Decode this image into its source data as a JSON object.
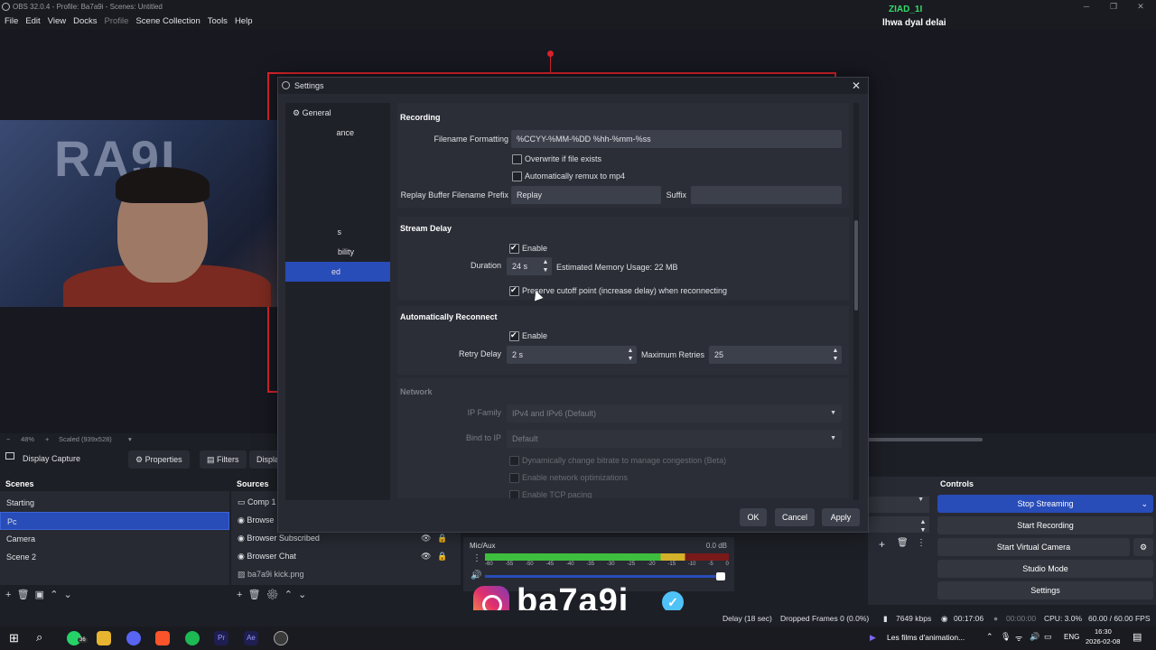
{
  "window": {
    "title": "OBS 32.0.4 - Profile: Ba7a9i - Scenes: Untitled"
  },
  "menu": [
    "File",
    "Edit",
    "View",
    "Docks",
    "Profile",
    "Scene Collection",
    "Tools",
    "Help"
  ],
  "overlay": {
    "name": "ZIAD_1I",
    "chat": "lhwa dyal delai"
  },
  "zoom": {
    "percent": "48%",
    "scaled": "Scaled (939x528)"
  },
  "source_toolbar": {
    "source": "Display Capture",
    "properties": "Properties",
    "filters": "Filters",
    "display": "Displa"
  },
  "scenes": {
    "title": "Scenes",
    "items": [
      "Starting",
      "Pc",
      "Camera",
      "Scene 2"
    ],
    "selected": 1
  },
  "sources": {
    "title": "Sources",
    "items": [
      "Comp 1",
      "Browse",
      "Browser Subscribed",
      "Browser Chat",
      "ba7a9i kick.png"
    ]
  },
  "mixer": {
    "channel": "Mic/Aux",
    "level": "0.0 dB",
    "ticks": [
      "-60",
      "-55",
      "-50",
      "-45",
      "-40",
      "-35",
      "-30",
      "-25",
      "-20",
      "-15",
      "-10",
      "-5",
      "0"
    ]
  },
  "controls": {
    "title": "Controls",
    "stop_streaming": "Stop Streaming",
    "start_recording": "Start Recording",
    "start_virtual_camera": "Start Virtual Camera",
    "studio_mode": "Studio Mode",
    "settings": "Settings"
  },
  "status": {
    "delay": "Delay (18 sec)",
    "dropped": "Dropped Frames 0 (0.0%)",
    "kbps": "7649 kbps",
    "stream_time": "00:17:06",
    "rec_time": "00:00:00",
    "cpu": "CPU: 3.0%",
    "fps": "60.00 / 60.00 FPS"
  },
  "taskbar": {
    "notification": "Les films d'animation...",
    "lang": "ENG",
    "time": "16:30",
    "date": "2026-02-08",
    "badge": "36"
  },
  "instagram": {
    "handle": "ba7a9i"
  },
  "settings": {
    "title": "Settings",
    "nav": [
      "General",
      "ance",
      "s",
      "bility",
      "ed"
    ],
    "recording": {
      "title": "Recording",
      "filename_label": "Filename Formatting",
      "filename_value": "%CCYY-%MM-%DD %hh-%mm-%ss",
      "overwrite": "Overwrite if file exists",
      "remux": "Automatically remux to mp4",
      "prefix_label": "Replay Buffer Filename Prefix",
      "prefix_value": "Replay",
      "suffix_label": "Suffix",
      "suffix_value": ""
    },
    "stream_delay": {
      "title": "Stream Delay",
      "enable": "Enable",
      "duration_label": "Duration",
      "duration_value": "24 s",
      "memory": "Estimated Memory Usage: 22 MB",
      "preserve": "Preserve cutoff point (increase delay) when reconnecting"
    },
    "reconnect": {
      "title": "Automatically Reconnect",
      "enable": "Enable",
      "retry_label": "Retry Delay",
      "retry_value": "2 s",
      "max_label": "Maximum Retries",
      "max_value": "25"
    },
    "network": {
      "title": "Network",
      "ip_family_label": "IP Family",
      "ip_family_value": "IPv4 and IPv6 (Default)",
      "bind_label": "Bind to IP",
      "bind_value": "Default",
      "dynamic": "Dynamically change bitrate to manage congestion (Beta)",
      "optimizations": "Enable network optimizations",
      "tcp": "Enable TCP pacing"
    },
    "buttons": {
      "ok": "OK",
      "cancel": "Cancel",
      "apply": "Apply"
    }
  }
}
